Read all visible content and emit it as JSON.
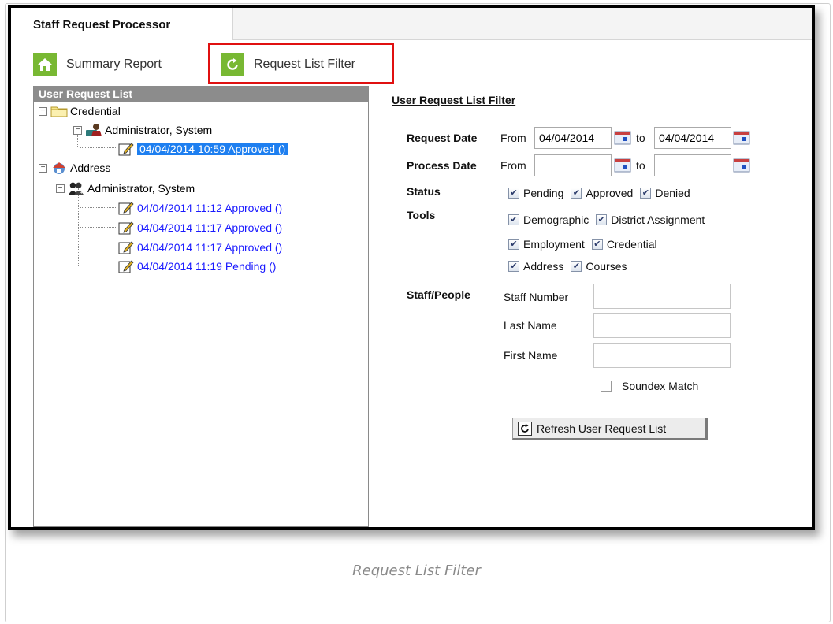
{
  "app": {
    "title": "Staff Request Processor"
  },
  "toolbar": {
    "summary_label": "Summary Report",
    "filter_label": "Request List Filter"
  },
  "left_panel": {
    "header": "User Request List",
    "credential_folder": "Credential",
    "credential_user": "Administrator, System",
    "credential_requests": [
      "04/04/2014 10:59  Approved ()"
    ],
    "address_folder": "Address",
    "address_user": "Administrator, System",
    "address_requests": [
      "04/04/2014 11:12  Approved ()",
      "04/04/2014 11:17  Approved ()",
      "04/04/2014 11:17  Approved ()",
      "04/04/2014 11:19  Pending ()"
    ]
  },
  "filter": {
    "title": "User Request List Filter",
    "request_date_label": "Request Date",
    "process_date_label": "Process Date",
    "from_label": "From",
    "to_label": "to",
    "request_from": "04/04/2014",
    "request_to": "04/04/2014",
    "process_from": "",
    "process_to": "",
    "status_label": "Status",
    "status_options": [
      {
        "label": "Pending",
        "checked": true
      },
      {
        "label": "Approved",
        "checked": true
      },
      {
        "label": "Denied",
        "checked": true
      }
    ],
    "tools_label": "Tools",
    "tools_options": [
      {
        "label": "Demographic",
        "checked": true
      },
      {
        "label": "District Assignment",
        "checked": true
      },
      {
        "label": "Employment",
        "checked": true
      },
      {
        "label": "Credential",
        "checked": true
      },
      {
        "label": "Address",
        "checked": true
      },
      {
        "label": "Courses",
        "checked": true
      }
    ],
    "staff_label": "Staff/People",
    "staff_number_label": "Staff Number",
    "last_name_label": "Last Name",
    "first_name_label": "First Name",
    "staff_number": "",
    "last_name": "",
    "first_name": "",
    "soundex_label": "Soundex Match",
    "soundex_checked": false,
    "refresh_label": "Refresh User Request List"
  },
  "caption": "Request List Filter",
  "colors": {
    "accent_green": "#78b833",
    "highlight_red": "#e01010",
    "link_blue": "#1a1aff",
    "selection_blue": "#1e7ff0",
    "panel_header": "#8c8c8c"
  }
}
